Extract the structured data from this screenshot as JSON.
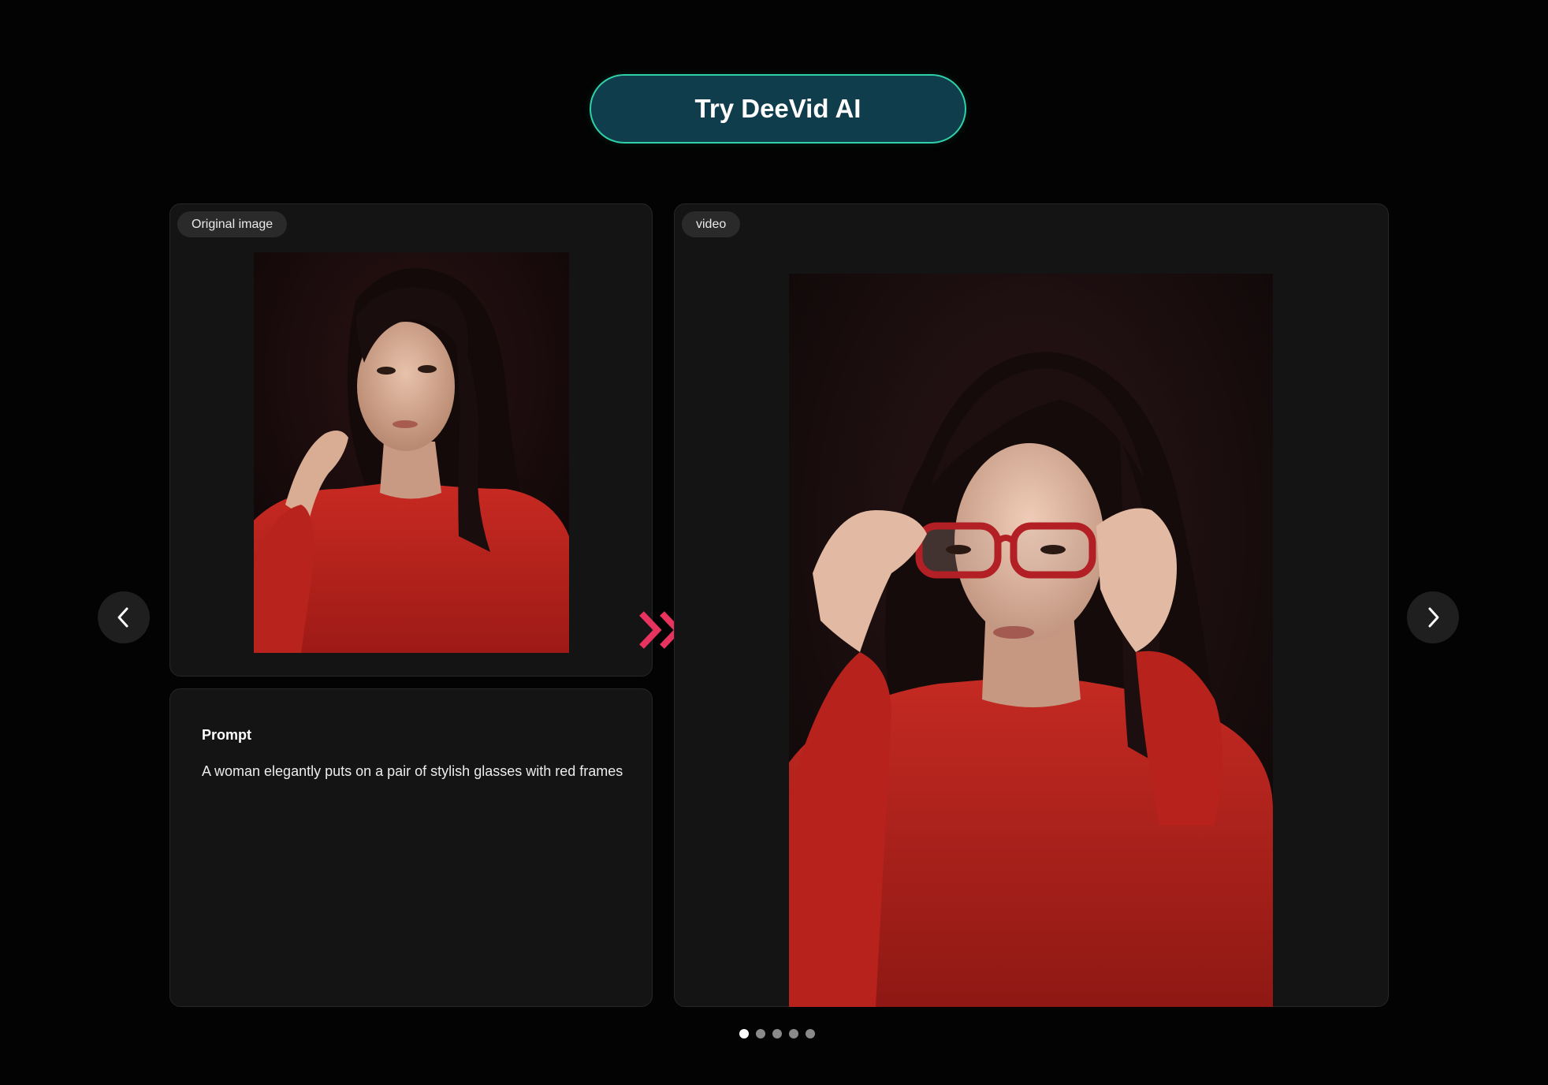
{
  "hero": {
    "cta_label": "Try DeeVid AI"
  },
  "original_panel": {
    "tag": "Original image",
    "image_icon": "portrait-photo-icon"
  },
  "prompt_panel": {
    "title": "Prompt",
    "text": "A woman elegantly puts on a pair of stylish glasses with red frames"
  },
  "video_panel": {
    "tag": "video",
    "image_icon": "portrait-video-frame-icon"
  },
  "carousel": {
    "prev_icon": "chevron-left-icon",
    "next_icon": "chevron-right-icon",
    "transition_icon": "double-chevron-right-icon",
    "dot_count": 5,
    "active_index": 0
  },
  "colors": {
    "background": "#030303",
    "panel": "#141414",
    "cta_fill": "#0f3d4c",
    "cta_border": "#2fd1a8",
    "accent_arrow": "#e8335f",
    "sweater_red": "#c0211c"
  }
}
